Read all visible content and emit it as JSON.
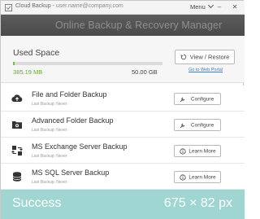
{
  "titlebar": {
    "app_name": "Cloud Backup",
    "user": "user.name@company.com",
    "menu_label": "Menu",
    "minimize": "–",
    "close": "✕"
  },
  "banner": {
    "title": "Online Backup & Recovery Manager"
  },
  "used_space": {
    "label": "Used Space",
    "used": "385.19 MB",
    "total": "50.00 GB",
    "fill_fraction": 0.0075,
    "view_restore_label": "View / Restore",
    "web_portal_link": "Go to Web Portal"
  },
  "rows": [
    {
      "title": "File and Folder Backup",
      "sub": "Last Backup: Never",
      "button": "Configure",
      "icon": "cloud-upload-icon"
    },
    {
      "title": "Advanced Folder Backup",
      "sub": "Last Backup: Never",
      "button": "Configure",
      "icon": "folder-camera-icon"
    },
    {
      "title": "MS Exchange Server Backup",
      "sub": "Last Backup: Never",
      "button": "Learn More",
      "icon": "exchange-server-icon"
    },
    {
      "title": "MS SQL Server Backup",
      "sub": "Last Backup: Never",
      "button": "Learn More",
      "icon": "database-icon"
    }
  ],
  "overlay": {
    "status": "Success",
    "dimensions": "675 × 82 px"
  },
  "colors": {
    "progress_fill": "#7bbd3a",
    "used_text": "#6aab2a",
    "banner_bg": "#4f4f4f",
    "overlay_bg": "#9fd6d1",
    "link": "#3a7bc8"
  }
}
